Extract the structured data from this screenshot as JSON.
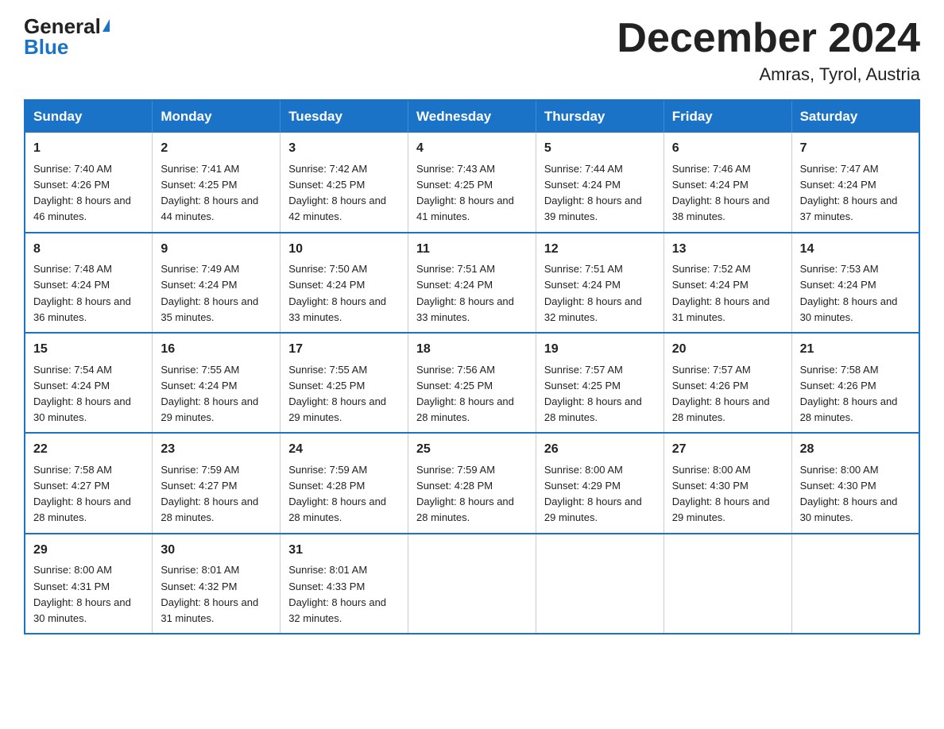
{
  "logo": {
    "general": "General",
    "blue": "Blue"
  },
  "header": {
    "title": "December 2024",
    "subtitle": "Amras, Tyrol, Austria"
  },
  "days_of_week": [
    "Sunday",
    "Monday",
    "Tuesday",
    "Wednesday",
    "Thursday",
    "Friday",
    "Saturday"
  ],
  "weeks": [
    [
      {
        "day": "1",
        "sunrise": "7:40 AM",
        "sunset": "4:26 PM",
        "daylight": "8 hours and 46 minutes."
      },
      {
        "day": "2",
        "sunrise": "7:41 AM",
        "sunset": "4:25 PM",
        "daylight": "8 hours and 44 minutes."
      },
      {
        "day": "3",
        "sunrise": "7:42 AM",
        "sunset": "4:25 PM",
        "daylight": "8 hours and 42 minutes."
      },
      {
        "day": "4",
        "sunrise": "7:43 AM",
        "sunset": "4:25 PM",
        "daylight": "8 hours and 41 minutes."
      },
      {
        "day": "5",
        "sunrise": "7:44 AM",
        "sunset": "4:24 PM",
        "daylight": "8 hours and 39 minutes."
      },
      {
        "day": "6",
        "sunrise": "7:46 AM",
        "sunset": "4:24 PM",
        "daylight": "8 hours and 38 minutes."
      },
      {
        "day": "7",
        "sunrise": "7:47 AM",
        "sunset": "4:24 PM",
        "daylight": "8 hours and 37 minutes."
      }
    ],
    [
      {
        "day": "8",
        "sunrise": "7:48 AM",
        "sunset": "4:24 PM",
        "daylight": "8 hours and 36 minutes."
      },
      {
        "day": "9",
        "sunrise": "7:49 AM",
        "sunset": "4:24 PM",
        "daylight": "8 hours and 35 minutes."
      },
      {
        "day": "10",
        "sunrise": "7:50 AM",
        "sunset": "4:24 PM",
        "daylight": "8 hours and 33 minutes."
      },
      {
        "day": "11",
        "sunrise": "7:51 AM",
        "sunset": "4:24 PM",
        "daylight": "8 hours and 33 minutes."
      },
      {
        "day": "12",
        "sunrise": "7:51 AM",
        "sunset": "4:24 PM",
        "daylight": "8 hours and 32 minutes."
      },
      {
        "day": "13",
        "sunrise": "7:52 AM",
        "sunset": "4:24 PM",
        "daylight": "8 hours and 31 minutes."
      },
      {
        "day": "14",
        "sunrise": "7:53 AM",
        "sunset": "4:24 PM",
        "daylight": "8 hours and 30 minutes."
      }
    ],
    [
      {
        "day": "15",
        "sunrise": "7:54 AM",
        "sunset": "4:24 PM",
        "daylight": "8 hours and 30 minutes."
      },
      {
        "day": "16",
        "sunrise": "7:55 AM",
        "sunset": "4:24 PM",
        "daylight": "8 hours and 29 minutes."
      },
      {
        "day": "17",
        "sunrise": "7:55 AM",
        "sunset": "4:25 PM",
        "daylight": "8 hours and 29 minutes."
      },
      {
        "day": "18",
        "sunrise": "7:56 AM",
        "sunset": "4:25 PM",
        "daylight": "8 hours and 28 minutes."
      },
      {
        "day": "19",
        "sunrise": "7:57 AM",
        "sunset": "4:25 PM",
        "daylight": "8 hours and 28 minutes."
      },
      {
        "day": "20",
        "sunrise": "7:57 AM",
        "sunset": "4:26 PM",
        "daylight": "8 hours and 28 minutes."
      },
      {
        "day": "21",
        "sunrise": "7:58 AM",
        "sunset": "4:26 PM",
        "daylight": "8 hours and 28 minutes."
      }
    ],
    [
      {
        "day": "22",
        "sunrise": "7:58 AM",
        "sunset": "4:27 PM",
        "daylight": "8 hours and 28 minutes."
      },
      {
        "day": "23",
        "sunrise": "7:59 AM",
        "sunset": "4:27 PM",
        "daylight": "8 hours and 28 minutes."
      },
      {
        "day": "24",
        "sunrise": "7:59 AM",
        "sunset": "4:28 PM",
        "daylight": "8 hours and 28 minutes."
      },
      {
        "day": "25",
        "sunrise": "7:59 AM",
        "sunset": "4:28 PM",
        "daylight": "8 hours and 28 minutes."
      },
      {
        "day": "26",
        "sunrise": "8:00 AM",
        "sunset": "4:29 PM",
        "daylight": "8 hours and 29 minutes."
      },
      {
        "day": "27",
        "sunrise": "8:00 AM",
        "sunset": "4:30 PM",
        "daylight": "8 hours and 29 minutes."
      },
      {
        "day": "28",
        "sunrise": "8:00 AM",
        "sunset": "4:30 PM",
        "daylight": "8 hours and 30 minutes."
      }
    ],
    [
      {
        "day": "29",
        "sunrise": "8:00 AM",
        "sunset": "4:31 PM",
        "daylight": "8 hours and 30 minutes."
      },
      {
        "day": "30",
        "sunrise": "8:01 AM",
        "sunset": "4:32 PM",
        "daylight": "8 hours and 31 minutes."
      },
      {
        "day": "31",
        "sunrise": "8:01 AM",
        "sunset": "4:33 PM",
        "daylight": "8 hours and 32 minutes."
      },
      null,
      null,
      null,
      null
    ]
  ]
}
